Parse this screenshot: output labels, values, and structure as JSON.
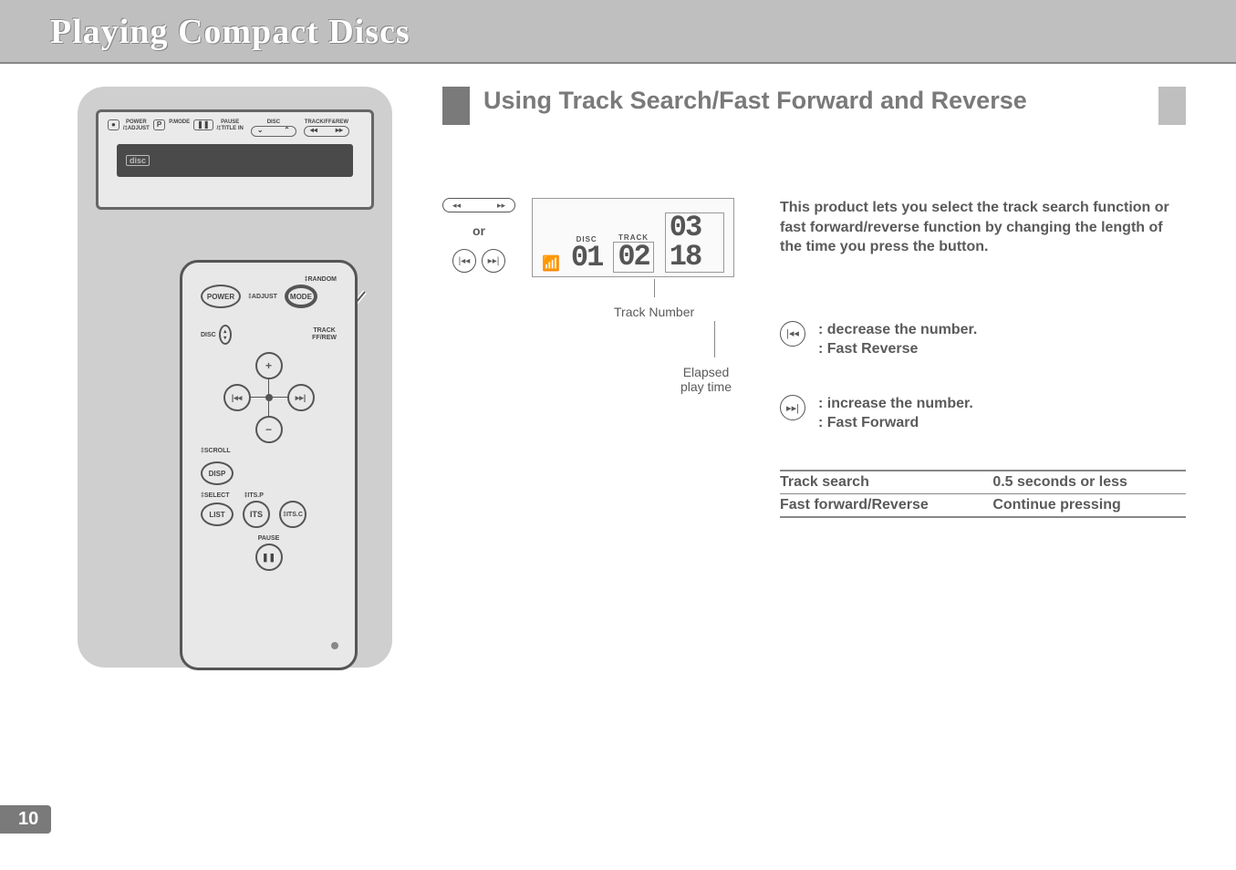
{
  "header": {
    "title": "Playing Compact Discs"
  },
  "page_number": "10",
  "section": {
    "title": "Using Track Search/Fast Forward and Reverse"
  },
  "head_unit": {
    "btn_power": "POWER\n/‡ADJUST",
    "btn_pmode": "P.MODE",
    "btn_pause": "PAUSE\n/‡TITLE IN",
    "label_disc": "DISC",
    "label_track": "TRACK/FF&REW"
  },
  "remote": {
    "random": "‡RANDOM",
    "power": "POWER",
    "adjust": "‡ADJUST",
    "mode": "MODE",
    "disc": "DISC",
    "track": "TRACK\nFF/REW",
    "scroll": "‡SCROLL",
    "disp": "DISP",
    "select": "‡SELECT",
    "itsp": "‡ITS.P",
    "list": "LIST",
    "its": "ITS",
    "itsc": "‡ITS.C",
    "pause": "PAUSE"
  },
  "controls": {
    "or": "or"
  },
  "lcd": {
    "disc_label": "DISC",
    "track_label": "TRACK",
    "disc_num": "01",
    "track_num": "02",
    "time": "03 18",
    "callout_track": "Track Number",
    "callout_time": "Elapsed play time"
  },
  "intro": "This product lets you select the track search function or fast forward/reverse function by changing the length of the time you press the button.",
  "icon_prev": {
    "line1": ": decrease the number.",
    "line2": ": Fast Reverse"
  },
  "icon_next": {
    "line1": ": increase the number.",
    "line2": ": Fast Forward"
  },
  "table": {
    "r1c1": "Track search",
    "r1c2": "0.5 seconds or less",
    "r2c1": "Fast forward/Reverse",
    "r2c2": "Continue pressing"
  }
}
